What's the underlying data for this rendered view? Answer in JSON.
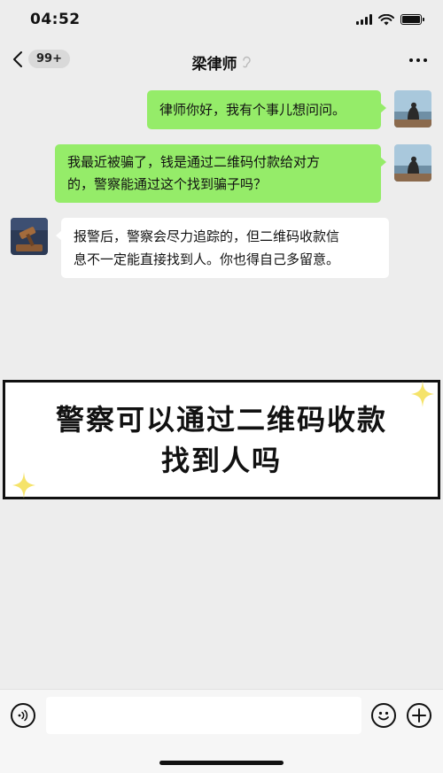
{
  "status_bar": {
    "time": "04:52"
  },
  "nav": {
    "back_badge": "99+",
    "title": "梁律师"
  },
  "messages": [
    {
      "from": "me",
      "text": "律师你好，我有个事儿想问问。"
    },
    {
      "from": "me",
      "lines": [
        "我最近被骗了，钱是通过二维码付款给对方",
        "的，警察能通过这个找到骗子吗？"
      ]
    },
    {
      "from": "lawyer",
      "lines": [
        "报警后，警察会尽力追踪的，但二维码收款信",
        "息不一定能直接找到人。你也得自己多留意。"
      ]
    }
  ],
  "banner": {
    "line1": "警察可以通过二维码收款",
    "line2": "找到人吗"
  },
  "input": {
    "placeholder": "",
    "value": ""
  },
  "colors": {
    "outgoing_bubble": "#95ec69",
    "incoming_bubble": "#ffffff",
    "background": "#ededed",
    "sparkle": "#f5e36a"
  },
  "icons": [
    "chevron-left-icon",
    "ear-icon",
    "more-icon",
    "voice-icon",
    "emoji-icon",
    "plus-icon",
    "sparkle-icon"
  ]
}
